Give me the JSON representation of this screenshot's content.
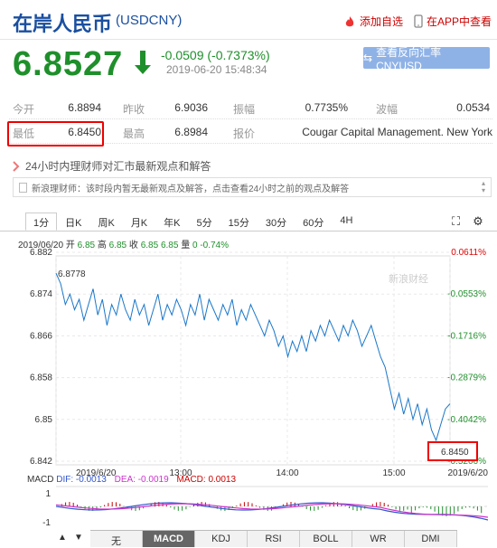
{
  "header": {
    "title": "在岸人民币",
    "code": "(USDCNY)",
    "add_fav": "添加自选",
    "app_view": "在APP中查看"
  },
  "quote": {
    "price": "6.8527",
    "change": "-0.0509 (-0.7373%)",
    "timestamp": "2019-06-20 15:48:34",
    "reverse_button": "查看反向汇率 CNYUSD"
  },
  "stats": [
    {
      "l1": "今开",
      "v1": "6.8894",
      "l2": "昨收",
      "v2": "6.9036",
      "l3": "振幅",
      "v3": "0.7735%",
      "l4": "波幅",
      "v4": "0.0534"
    },
    {
      "l1": "最低",
      "v1": "6.8450",
      "l2": "最高",
      "v2": "6.8984",
      "l3": "报价",
      "v3": "Cougar Capital Management. New York",
      "l4": "",
      "v4": ""
    }
  ],
  "news": {
    "headline": "24小时内理财师对汇市最新观点和解答",
    "box_text": "新浪理财师：该时段内暂无最新观点及解答，点击查看24小时之前的观点及解答"
  },
  "tabs": [
    "1分",
    "日K",
    "周K",
    "月K",
    "年K",
    "5分",
    "15分",
    "30分",
    "60分",
    "4H"
  ],
  "active_tab": "1分",
  "ohlc_line": {
    "date": "2019/06/20",
    "open_label": "开",
    "open": "6.85",
    "high_label": "高",
    "high": "6.85",
    "close_label": "收",
    "close": "6.85",
    "latest": "6.85",
    "vol_label": "量",
    "vol": "0",
    "pct": "-0.74%"
  },
  "watermark": "新浪财经",
  "chart_data": {
    "type": "line",
    "y_ticks": [
      "6.882",
      "6.874",
      "6.866",
      "6.858",
      "6.85",
      "6.842"
    ],
    "pct_ticks": [
      "0.0611%",
      "-0.0553%",
      "-0.1716%",
      "-0.2879%",
      "-0.4042%",
      "-0.5206%"
    ],
    "x_ticks": [
      "2019/6/20",
      "13:00",
      "14:00",
      "15:00",
      "2019/6/20"
    ],
    "ylim": [
      6.842,
      6.882
    ],
    "high_label": "6.8778",
    "low_label": "6.8450",
    "series": [
      {
        "values": [
          6.878,
          6.876,
          6.872,
          6.874,
          6.871,
          6.873,
          6.869,
          6.872,
          6.875,
          6.87,
          6.873,
          6.868,
          6.872,
          6.87,
          6.874,
          6.871,
          6.869,
          6.873,
          6.87,
          6.872,
          6.868,
          6.871,
          6.874,
          6.869,
          6.872,
          6.87,
          6.873,
          6.871,
          6.868,
          6.872,
          6.87,
          6.874,
          6.869,
          6.873,
          6.871,
          6.869,
          6.872,
          6.87,
          6.873,
          6.868,
          6.871,
          6.869,
          6.872,
          6.87,
          6.868,
          6.866,
          6.869,
          6.867,
          6.864,
          6.866,
          6.862,
          6.865,
          6.863,
          6.866,
          6.863,
          6.867,
          6.865,
          6.868,
          6.866,
          6.869,
          6.867,
          6.865,
          6.868,
          6.866,
          6.869,
          6.867,
          6.864,
          6.866,
          6.868,
          6.865,
          6.862,
          6.86,
          6.856,
          6.852,
          6.855,
          6.851,
          6.854,
          6.85,
          6.853,
          6.849,
          6.852,
          6.848,
          6.846,
          6.849,
          6.852,
          6.853
        ]
      }
    ]
  },
  "macd": {
    "label": "MACD",
    "dif": "DIF: -0.0013",
    "dea": "DEA: -0.0019",
    "macd": "MACD: 0.0013",
    "ticks": [
      "1",
      "-1"
    ],
    "colors": {
      "dif": "#3355cc",
      "dea": "#cc33cc",
      "macd": "#cc0000"
    }
  },
  "bottom_tabs": [
    "无",
    "MACD",
    "KDJ",
    "RSI",
    "BOLL",
    "WR",
    "DMI"
  ],
  "bottom_active": "MACD",
  "colors": {
    "down": "#1f8f2b",
    "up": "#e00000",
    "brand": "#1a4fa0"
  }
}
